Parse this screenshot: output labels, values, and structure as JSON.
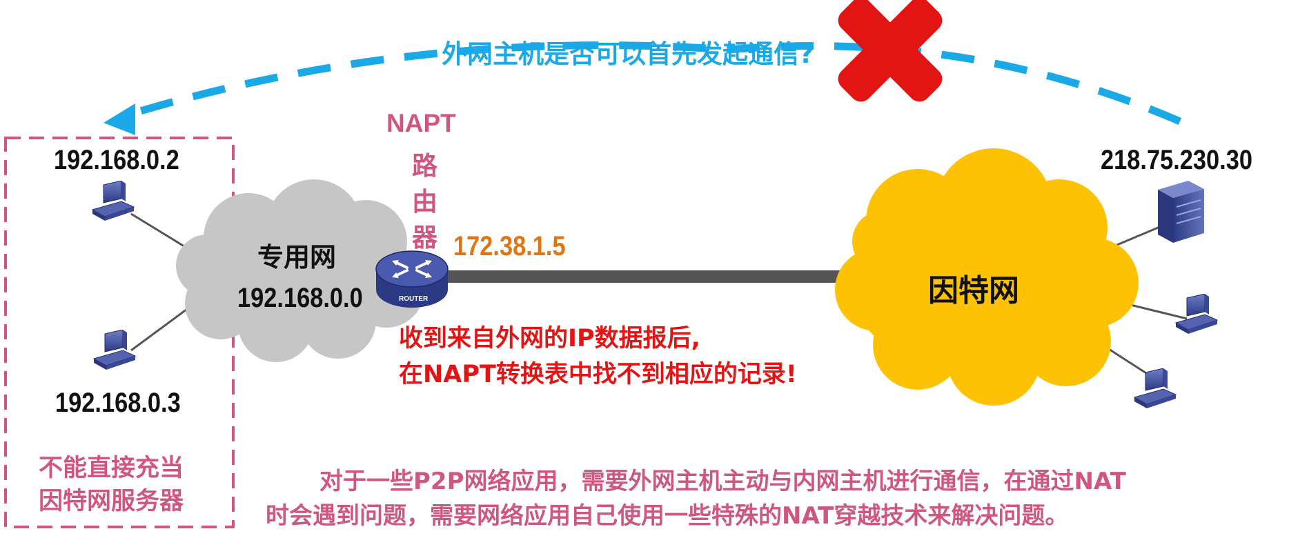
{
  "question": "外网主机是否可以首先发起通信?",
  "router": {
    "line1": "NAPT",
    "line2": "路",
    "line3": "由",
    "line4": "器",
    "icon_text": "ROUTER",
    "public_ip": "172.38.1.5"
  },
  "private_net": {
    "name": "专用网",
    "address": "192.168.0.0",
    "hosts": [
      "192.168.0.2",
      "192.168.0.3"
    ],
    "note_line1": "不能直接充当",
    "note_line2": "因特网服务器"
  },
  "internet": {
    "name": "因特网",
    "server_ip": "218.75.230.30"
  },
  "error_message": {
    "line1": "收到来自外网的IP数据报后,",
    "line2": "在NAPT转换表中找不到相应的记录!"
  },
  "footer": {
    "line1": "对于一些P2P网络应用，需要外网主机主动与内网主机进行通信，在通过NAT",
    "line2": "时会遇到问题，需要网络应用自己使用一些特殊的NAT穿越技术来解决问题。"
  },
  "colors": {
    "question_blue": "#1aa9e6",
    "pink": "#d05682",
    "orange": "#e07512",
    "red": "#e31414",
    "cloud_gray": "#c6c6c6",
    "cloud_yellow": "#fdc203",
    "link_gray": "#555555"
  },
  "icons": [
    "computer-icon",
    "server-icon",
    "router-icon",
    "cross-icon",
    "arrow-head"
  ]
}
